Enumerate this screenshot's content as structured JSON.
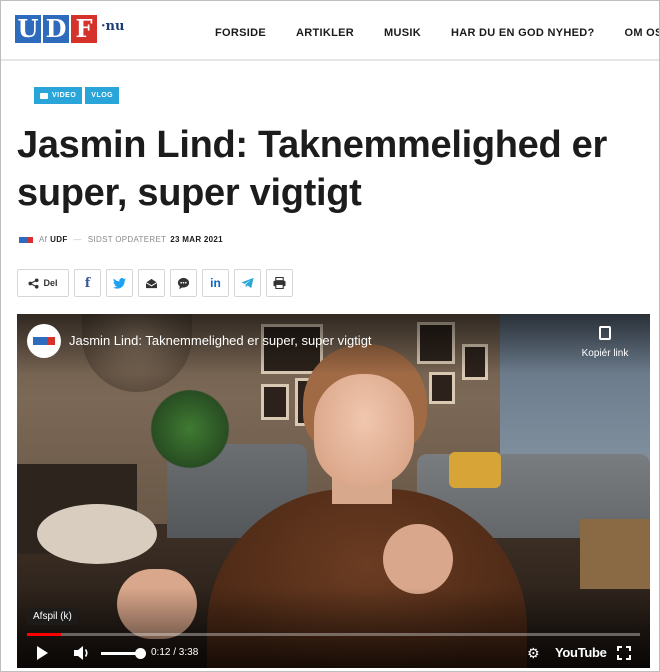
{
  "site": {
    "logo_letters": [
      "U",
      "D",
      "F"
    ],
    "logo_tld": "·nu",
    "nav": [
      "FORSIDE",
      "ARTIKLER",
      "MUSIK",
      "HAR DU EN GOD NYHED?",
      "OM OS"
    ]
  },
  "article": {
    "tags": [
      "VIDEO",
      "VLOG"
    ],
    "title": "Jasmin Lind: Taknemmelighed er super, super vigtigt",
    "meta": {
      "author_prefix": "Af",
      "author": "UDF",
      "dash": "—",
      "updated_label": "SIDST OPDATERET",
      "date": "23 MAR 2021"
    },
    "share": {
      "label": "Del",
      "buttons": [
        "facebook-icon",
        "twitter-icon",
        "email-icon",
        "messenger-icon",
        "linkedin-icon",
        "telegram-icon",
        "print-icon"
      ]
    }
  },
  "video": {
    "title": "Jasmin Lind: Taknemmelighed er super, super vigtigt",
    "copy_label": "Kopiér link",
    "tooltip": "Afspil (k)",
    "time": "0:12 / 3:38",
    "progress": 0.055,
    "brand": "YouTube"
  },
  "colors": {
    "accent": "#2aa5d9",
    "logo_blue": "#2f6bbd",
    "logo_red": "#d6322c",
    "progress_red": "#ff0000"
  }
}
